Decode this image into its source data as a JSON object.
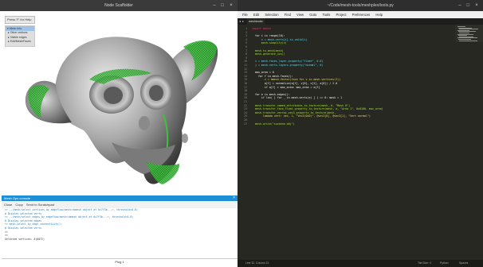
{
  "left_window": {
    "title": "Node Scaffolder",
    "press_f_button": "Press 'F' for Help",
    "options_panel": {
      "header": "Mesh Info",
      "items": [
        "Other vertices",
        "Visible edges",
        "Edit/Mesh/Faces"
      ]
    }
  },
  "console": {
    "title": "Mesh Ops console",
    "close_label": "×",
    "toolbar": [
      "Close",
      "Copy",
      "Send to Scratchpad"
    ],
    "lines": [
      ">> ../mesh/select_vertices_by_edgeflow(mesh=<bmesh object at 0x7f3b...>, threshold=0.8)",
      "# Display selected verts",
      ">> ../mesh/select_edges_by_edgeflow(mesh=<bmesh object at 0x7f3b...>, threshold=0.8)",
      "# Display selected edges",
      ">> mesh.select_by_edge_connectivity()",
      "# Display selected verts",
      ">>",
      ">>",
      "Selected vertices: 8(8072)"
    ],
    "input_value": "Plog 1"
  },
  "editor": {
    "title": "~/Code/mesh-tools/meshplex/tools.py",
    "menu": [
      "File",
      "Edit",
      "Selection",
      "Find",
      "View",
      "Goto",
      "Tools",
      "Project",
      "Preferences",
      "Help"
    ],
    "tab_nav": [
      "◂",
      "▸"
    ],
    "tab_label": "meshtools",
    "tab_close": "×",
    "code_lines": [
      {
        "n": "1",
        "t": "import bmesh",
        "c": "#f92672"
      },
      {
        "n": "2",
        "t": "",
        "c": "#f8f8f2"
      },
      {
        "n": "3",
        "t": "  for i in range(10):",
        "c": "#f8f8f2"
      },
      {
        "n": "4",
        "t": "      v = mesh.verts[i].is_valid(i)",
        "c": "#66d9ef"
      },
      {
        "n": "5",
        "t": "      mesh.simplify(v)",
        "c": "#a6e22e"
      },
      {
        "n": "6",
        "t": "",
        "c": "#f8f8f2"
      },
      {
        "n": "7",
        "t": "  mesh.to_mesh(mesh)",
        "c": "#a6e22e"
      },
      {
        "n": "8",
        "t": "  mesh.generate_uvs()",
        "c": "#a6e22e"
      },
      {
        "n": "9",
        "t": "",
        "c": "#f8f8f2"
      },
      {
        "n": "10",
        "t": "  i = mesh.faces_layer.property(\"float\", 0.0)",
        "c": "#66d9ef"
      },
      {
        "n": "11",
        "t": "  j = mesh.verts.layers.property(\"normal\", 0)",
        "c": "#66d9ef"
      },
      {
        "n": "12",
        "t": "",
        "c": "#f8f8f2"
      },
      {
        "n": "13",
        "t": "  max_area = 0",
        "c": "#f8f8f2"
      },
      {
        "n": "14",
        "t": "    for f in mesh.faces():",
        "c": "#f8f8f2"
      },
      {
        "n": "15",
        "t": "        v = bmesh.Vector(face for v in mesh.vertices(f))",
        "c": "#e6db74"
      },
      {
        "n": "16",
        "t": "        a[f] = normalize(a[f], v[0], v[1], a[0]) / 2.0",
        "c": "#f8f8f2"
      },
      {
        "n": "17",
        "t": "        if a[f] > max_area: max_area = a[f]",
        "c": "#f8f8f2"
      },
      {
        "n": "18",
        "t": "",
        "c": "#f8f8f2"
      },
      {
        "n": "19",
        "t": "  for e in mesh.edges():",
        "c": "#f8f8f2"
      },
      {
        "n": "20",
        "t": "      if len( [ for _ in mesh.verts(e) ] ) == 0: mask = 1",
        "c": "#f8f8f2"
      },
      {
        "n": "21",
        "t": "",
        "c": "#f8f8f2"
      },
      {
        "n": "22",
        "t": "  mesh.transfer_named_attributes_to_texture(mesh, 0, \"Mask 0\")",
        "c": "#a6e22e"
      },
      {
        "n": "23",
        "t": "  mesh.transfer_face_float_property_to_texture(mesh, a, \"Area 1\", 0x0100, max_area)",
        "c": "#a6e22e"
      },
      {
        "n": "24",
        "t": "  mesh.transfer_vertex_vec3_property_to_texture(mesh,",
        "c": "#a6e22e"
      },
      {
        "n": "25",
        "t": "       lambda vert: vec, 1, \"Vec3(0x0)\", @vec3[0], @vec3[1], \"Vert normal\")",
        "c": "#e6db74"
      },
      {
        "n": "26",
        "t": "",
        "c": "#f8f8f2"
      },
      {
        "n": "27",
        "t": "  mesh.write(\"suzanne.obj\")",
        "c": "#a6e22e"
      }
    ],
    "status_left": "Line 32, Column 21",
    "status_right": [
      "Tab Size: 4",
      "Python",
      "Spaces"
    ]
  }
}
